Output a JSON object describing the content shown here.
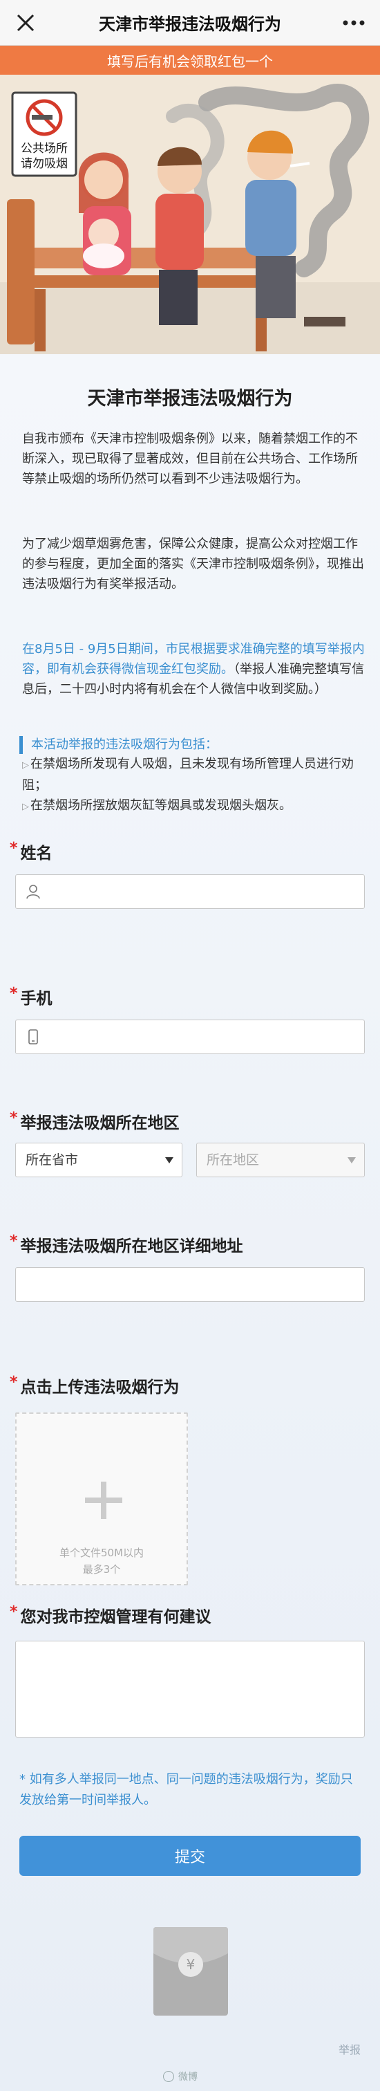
{
  "topbar": {
    "title": "天津市举报违法吸烟行为"
  },
  "banner": {
    "text": "填写后有机会领取红包一个"
  },
  "hero": {
    "sign_line1": "公共场所",
    "sign_line2": "请勿吸烟"
  },
  "article": {
    "title": "天津市举报违法吸烟行为",
    "p1": "自我市颁布《天津市控制吸烟条例》以来，随着禁烟工作的不断深入，现已取得了显著成效，但目前在公共场合、工作场所等禁止吸烟的场所仍然可以看到不少违法吸烟行为。",
    "p2": "为了减少烟草烟雾危害，保障公众健康，提高公众对控烟工作的参与程度，更加全面的落实《天津市控制吸烟条例》，现推出违法吸烟行为有奖举报活动。",
    "p3_highlight": "在8月5日 - 9月5日期间，市民根据要求准确完整的填写举报内容，即有机会获得微信现金红包奖励。",
    "p3_rest": "（举报人准确完整填写信息后，二十四小时内将有机会在个人微信中收到奖励。）",
    "rules_head": "本活动举报的违法吸烟行为包括：",
    "rules": [
      "在禁烟场所发现有人吸烟，且未发现有场所管理人员进行劝阻；",
      "在禁烟场所摆放烟灰缸等烟具或发现烟头烟灰。"
    ]
  },
  "form": {
    "required_mark": "*",
    "name_label": "姓名",
    "phone_label": "手机",
    "region_label": "举报违法吸烟所在地区",
    "province_placeholder": "所在省市",
    "area_placeholder": "所在地区",
    "address_label": "举报违法吸烟所在地区详细地址",
    "upload_label": "点击上传违法吸烟行为",
    "upload_hint1": "单个文件50M以内",
    "upload_hint2": "最多3个",
    "suggest_label": "您对我市控烟管理有何建议",
    "note": "* 如有多人举报同一地点、同一问题的违法吸烟行为，奖励只发放给第一时间举报人。",
    "submit_label": "提交"
  },
  "footer": {
    "report_label": "举报",
    "watermark": "微博"
  },
  "colors": {
    "accent": "#4192d9",
    "banner": "#ef7a43",
    "required": "#e02a2a"
  }
}
